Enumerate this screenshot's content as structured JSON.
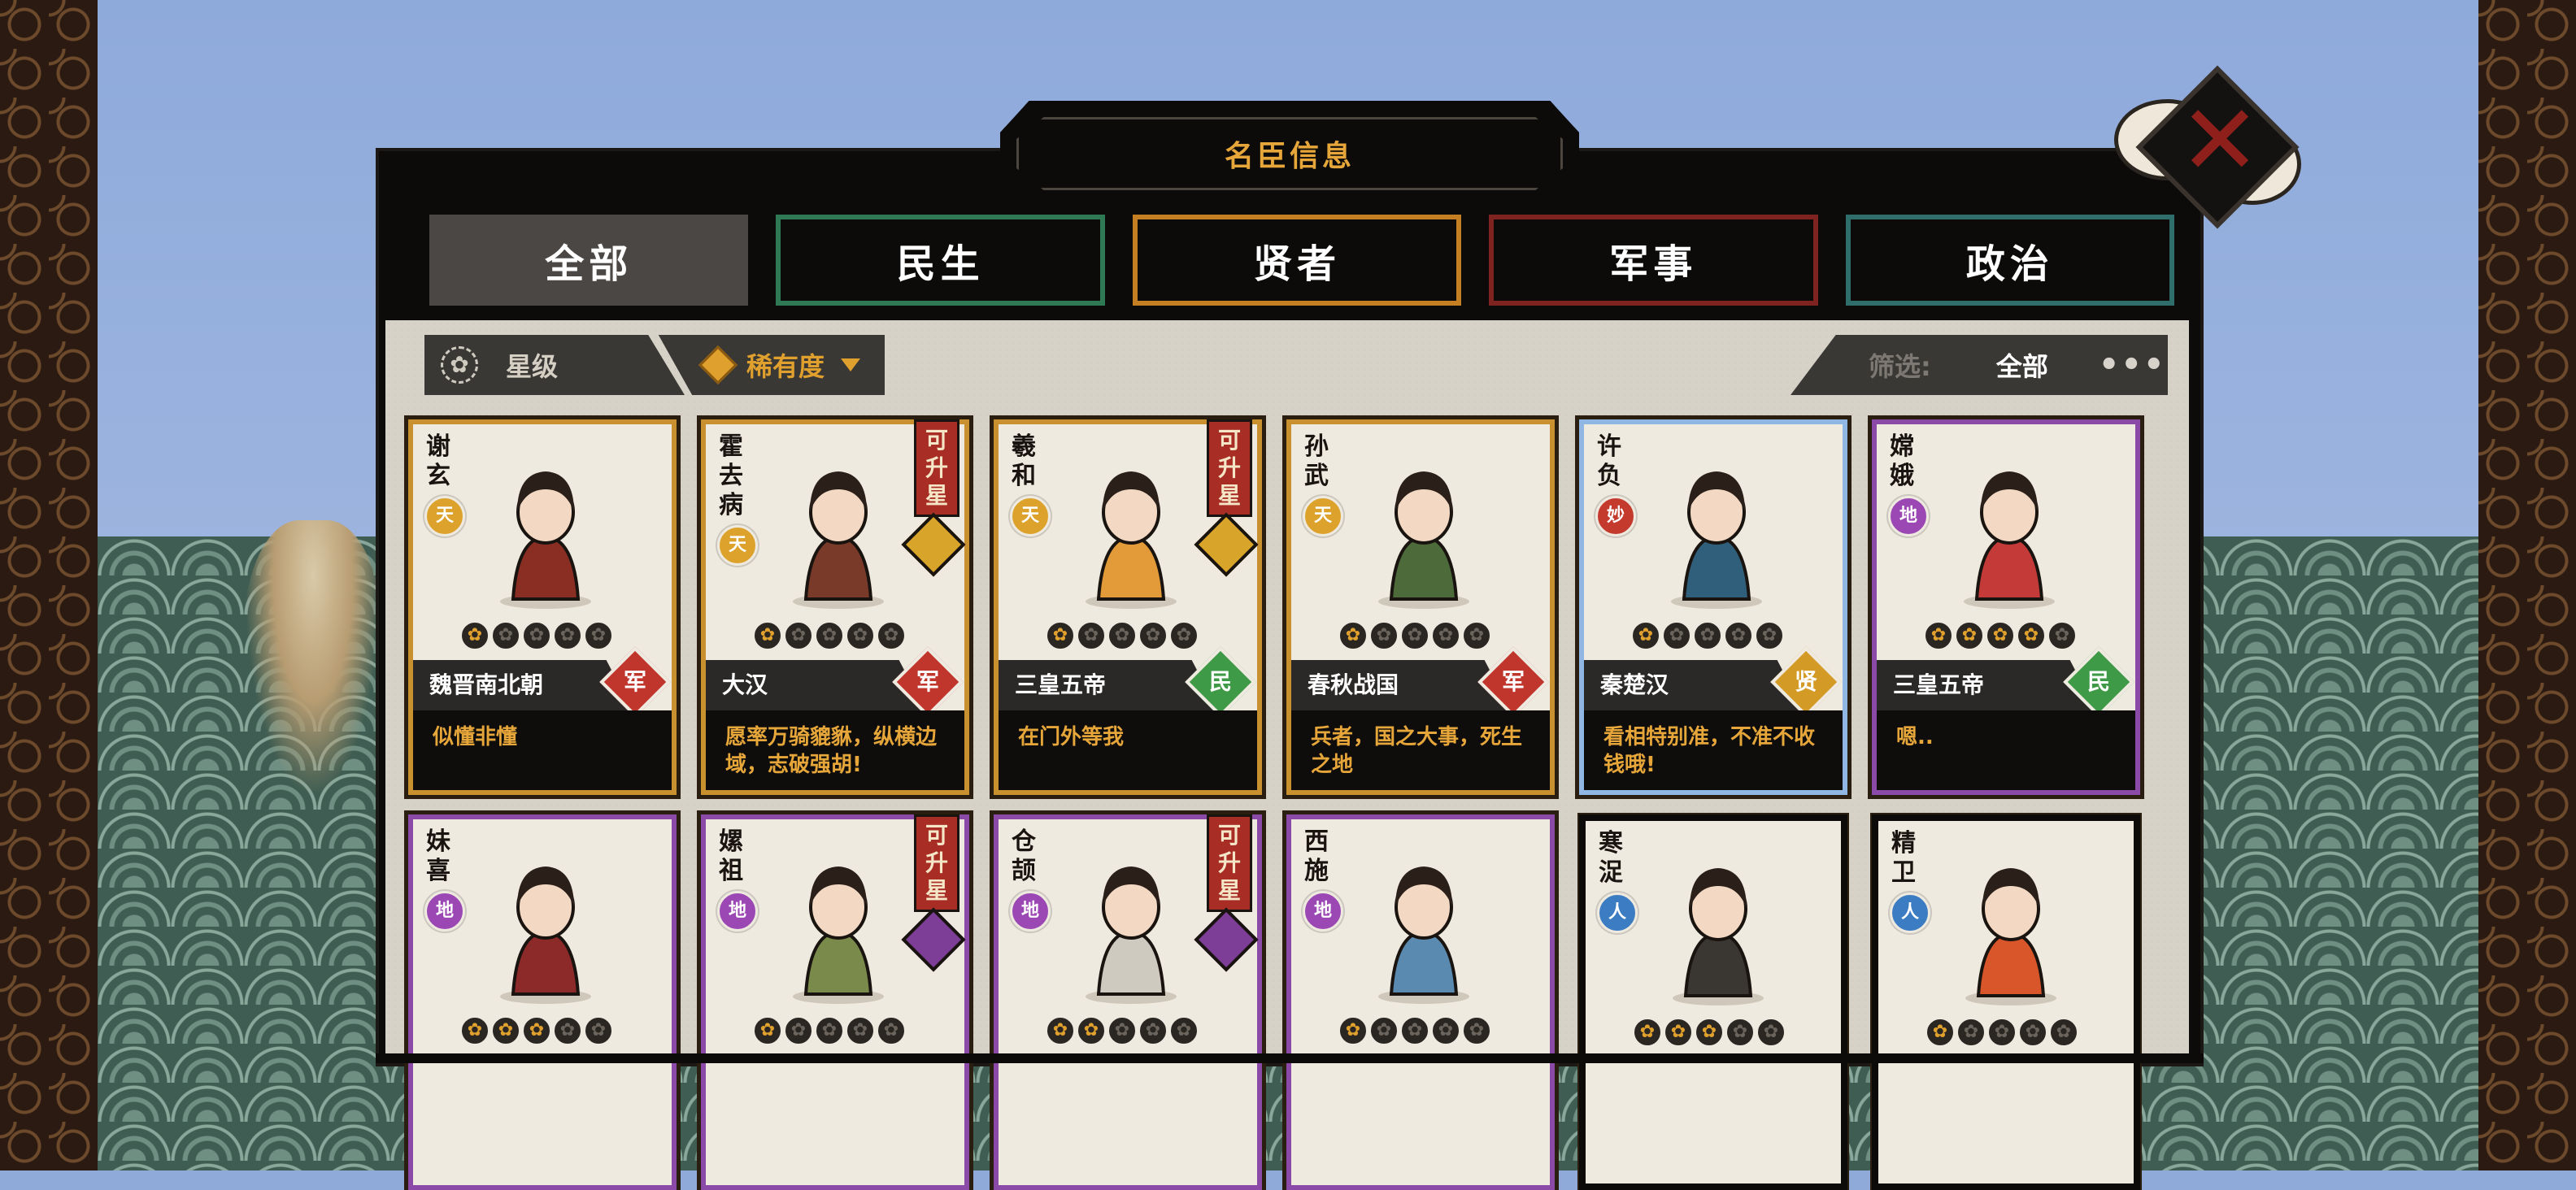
{
  "title": "名臣信息",
  "tabs": [
    {
      "label": "全部",
      "key": "all",
      "active": true
    },
    {
      "label": "民生",
      "key": "minsheng",
      "color": "#2f7a55"
    },
    {
      "label": "贤者",
      "key": "xianzhe",
      "color": "#c47f22"
    },
    {
      "label": "军事",
      "key": "junshi",
      "color": "#7e2320"
    },
    {
      "label": "政治",
      "key": "zhengzhi",
      "color": "#2f6e6a"
    }
  ],
  "sort": {
    "star_label": "星级",
    "rarity_label": "稀有度"
  },
  "filter": {
    "label": "筛选:",
    "value": "全部",
    "more": "•••"
  },
  "upgrade_label": [
    "可",
    "升",
    "星"
  ],
  "cards": [
    {
      "name": [
        "谢",
        "玄"
      ],
      "rarity": "天",
      "era": "魏晋南北朝",
      "type": "军",
      "quote": "似懂非懂",
      "stars": 1,
      "upgradable": false
    },
    {
      "name": [
        "霍",
        "去",
        "病"
      ],
      "rarity": "天",
      "era": "大汉",
      "type": "军",
      "quote": "愿率万骑貔貅，纵横边域，志破强胡!",
      "stars": 1,
      "upgradable": true
    },
    {
      "name": [
        "羲",
        "和"
      ],
      "rarity": "天",
      "era": "三皇五帝",
      "type": "民",
      "quote": "在门外等我",
      "stars": 1,
      "upgradable": true
    },
    {
      "name": [
        "孙",
        "武"
      ],
      "rarity": "天",
      "era": "春秋战国",
      "type": "军",
      "quote": "兵者，国之大事，死生之地",
      "stars": 1,
      "upgradable": false
    },
    {
      "name": [
        "许",
        "负"
      ],
      "rarity": "妙",
      "era": "秦楚汉",
      "type": "贤",
      "quote": "看相特别准，不准不收钱哦!",
      "stars": 1,
      "upgradable": false
    },
    {
      "name": [
        "嫦",
        "娥"
      ],
      "rarity": "地",
      "era": "三皇五帝",
      "type": "民",
      "quote": "嗯..",
      "stars": 4,
      "upgradable": false
    },
    {
      "name": [
        "妹",
        "喜"
      ],
      "rarity": "地",
      "stars": 3,
      "upgradable": false
    },
    {
      "name": [
        "嫘",
        "祖"
      ],
      "rarity": "地",
      "stars": 1,
      "upgradable": true
    },
    {
      "name": [
        "仓",
        "颉"
      ],
      "rarity": "地",
      "stars": 2,
      "upgradable": true
    },
    {
      "name": [
        "西",
        "施"
      ],
      "rarity": "地",
      "stars": 1,
      "upgradable": false
    },
    {
      "name": [
        "寒",
        "浞"
      ],
      "rarity": "人",
      "stars": 3,
      "upgradable": false
    },
    {
      "name": [
        "精",
        "卫"
      ],
      "rarity": "人",
      "stars": 1,
      "upgradable": false
    }
  ]
}
